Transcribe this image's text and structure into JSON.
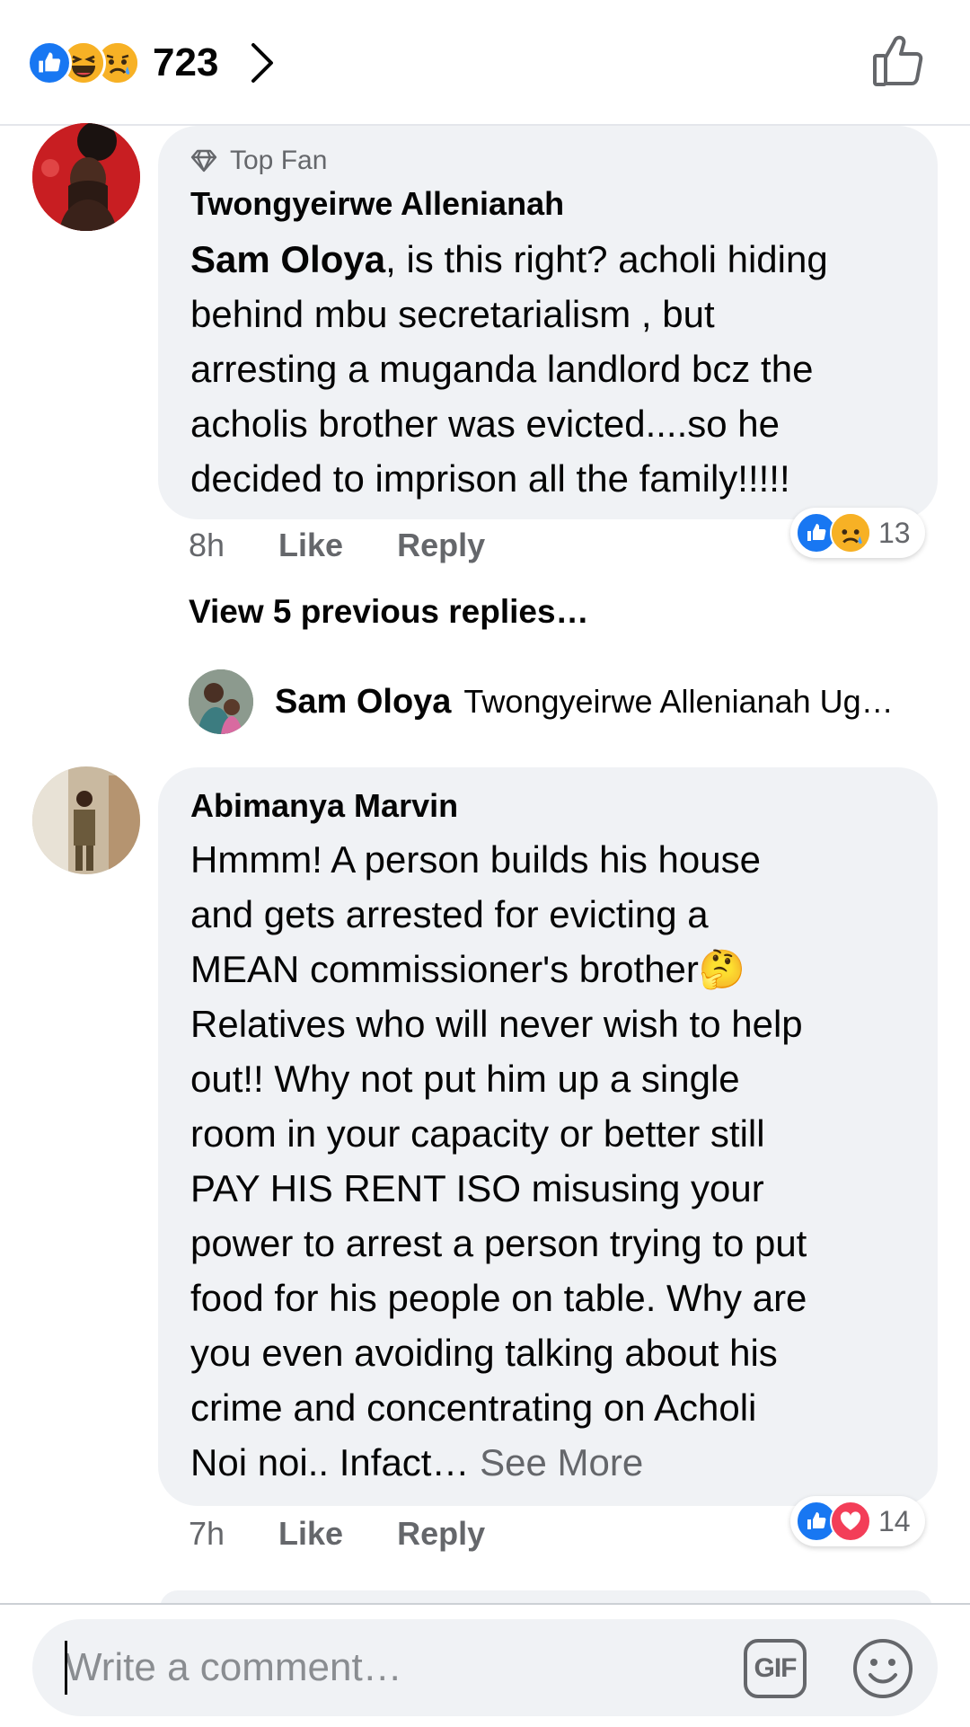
{
  "header": {
    "reaction_count": "723",
    "reaction_icons": [
      "like-icon",
      "haha-icon",
      "sad-icon"
    ]
  },
  "comments": [
    {
      "badge": "Top Fan",
      "author": "Twongyeirwe Allenianah",
      "mention": "Sam Oloya",
      "lines": [
        ", is this right? acholi hiding",
        "behind mbu secretarialism , but",
        "arresting a muganda landlord bcz the",
        "acholis brother was evicted....so he",
        "decided to imprison all the family!!!!!"
      ],
      "time": "8h",
      "like": "Like",
      "reply": "Reply",
      "reaction_count": "13",
      "reaction_icons": [
        "like-icon",
        "sad-icon"
      ]
    },
    {
      "author": "Abimanya Marvin",
      "lines": [
        "Hmmm! A person builds his house",
        "and gets arrested for evicting a",
        "MEAN commissioner's brother🤔",
        "Relatives who will never wish to help",
        "out!! Why not put him up a single",
        "room in your capacity or better still",
        "PAY HIS RENT ISO misusing your",
        "power to arrest a person trying to put",
        "food for his people on table. Why are",
        "you even avoiding talking about his",
        "crime and concentrating on Acholi",
        "Noi noi.. Infact…"
      ],
      "see_more": "See More",
      "time": "7h",
      "like": "Like",
      "reply": "Reply",
      "reaction_count": "14",
      "reaction_icons": [
        "like-icon",
        "love-icon"
      ]
    }
  ],
  "view_previous": "View 5 previous replies…",
  "latest_reply": {
    "author": "Sam Oloya",
    "snippet": "Twongyeirwe Allenianah  Ug…"
  },
  "composer": {
    "placeholder": "Write a comment…",
    "gif_label": "GIF"
  },
  "colors": {
    "accent": "#1877f2",
    "love": "#f33e58",
    "bubble": "#f0f2f5",
    "muted": "#65676b"
  }
}
